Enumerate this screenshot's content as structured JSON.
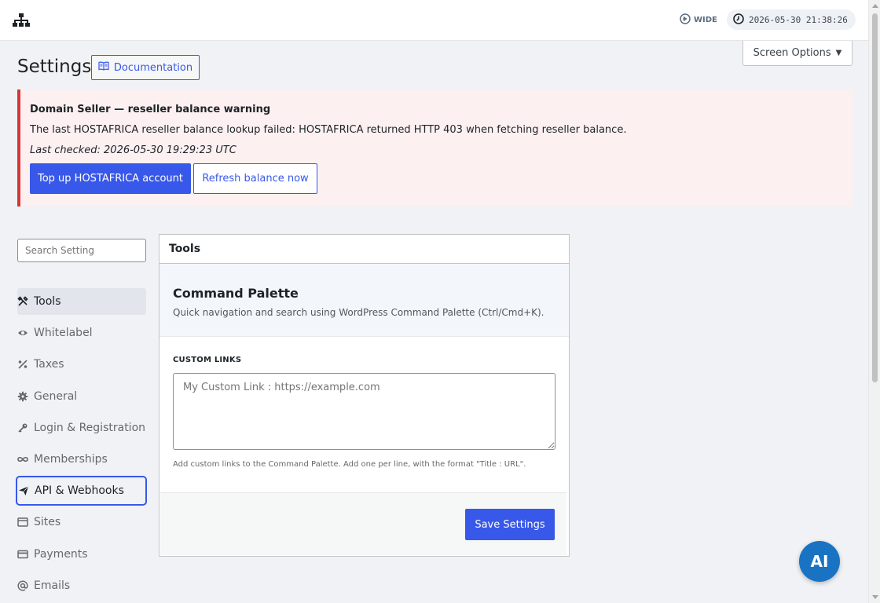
{
  "topbar": {
    "logo_icon": "sitemap-icon",
    "wide_label": "WIDE",
    "datetime": "2026-05-30 21:38:26"
  },
  "header": {
    "title": "Settings",
    "doc_button": "Documentation",
    "screen_options": "Screen Options"
  },
  "notice": {
    "title": "Domain Seller — reseller balance warning",
    "message": "The last HOSTAFRICA reseller balance lookup failed: HOSTAFRICA returned HTTP 403 when fetching reseller balance.",
    "last_checked": "Last checked: 2026-05-30 19:29:23 UTC",
    "primary_button": "Top up HOSTAFRICA account",
    "secondary_button": "Refresh balance now",
    "accent_color": "#d63638"
  },
  "sidebar": {
    "search_placeholder": "Search Setting",
    "items": [
      {
        "label": "Tools",
        "icon": "tools-icon"
      },
      {
        "label": "Whitelabel",
        "icon": "eye-icon"
      },
      {
        "label": "Taxes",
        "icon": "percent-icon"
      },
      {
        "label": "General",
        "icon": "gear-icon"
      },
      {
        "label": "Login & Registration",
        "icon": "key-icon"
      },
      {
        "label": "Memberships",
        "icon": "infinity-icon"
      },
      {
        "label": "API & Webhooks",
        "icon": "send-icon"
      },
      {
        "label": "Sites",
        "icon": "window-icon"
      },
      {
        "label": "Payments",
        "icon": "card-icon"
      },
      {
        "label": "Emails",
        "icon": "at-icon"
      }
    ]
  },
  "panel": {
    "title": "Tools",
    "command_palette": {
      "title": "Command Palette",
      "description": "Quick navigation and search using WordPress Command Palette (Ctrl/Cmd+K)."
    },
    "custom_links": {
      "label": "CUSTOM LINKS",
      "placeholder": "My Custom Link : https://example.com",
      "help": "Add custom links to the Command Palette. Add one per line, with the format \"Title : URL\"."
    },
    "save_button": "Save Settings"
  },
  "fab": {
    "label": "AI",
    "color": "#1a73c2"
  },
  "colors": {
    "brand": "#3858e9",
    "background": "#f0f2f5"
  }
}
